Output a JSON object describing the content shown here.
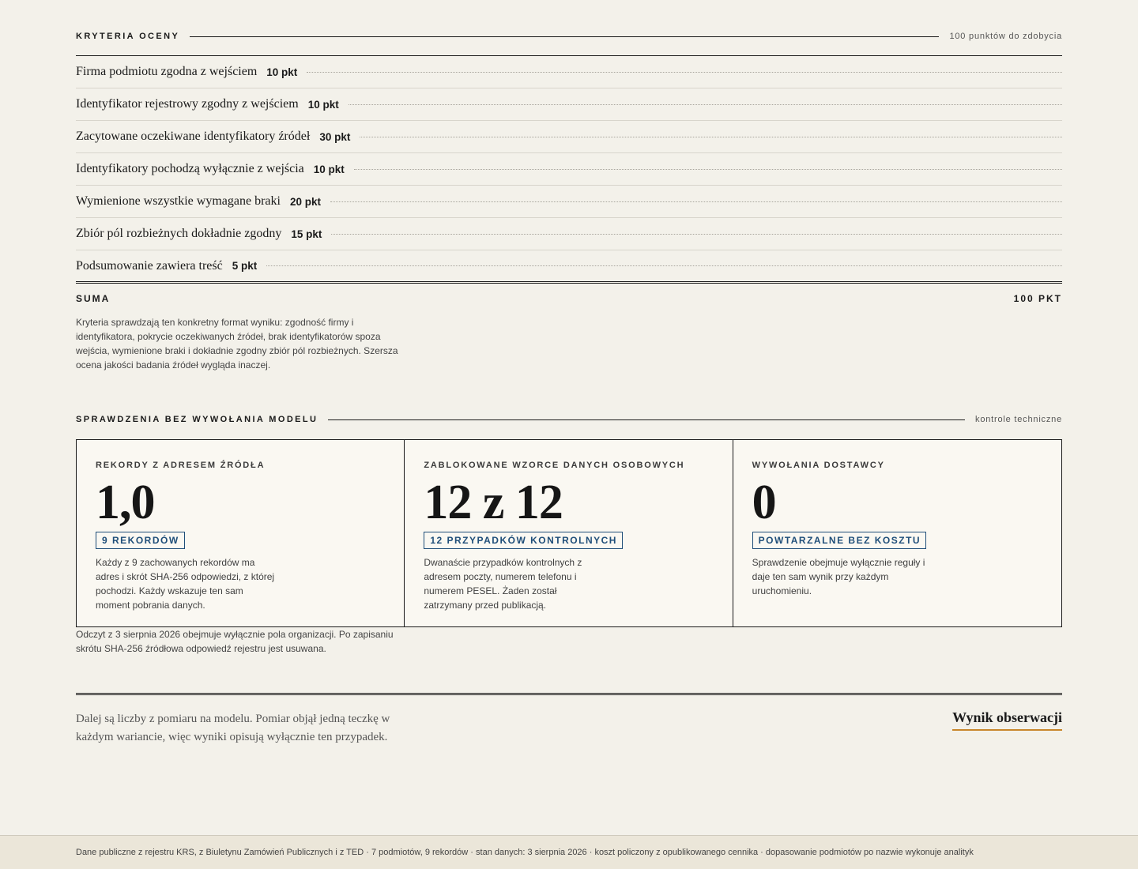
{
  "criteria": {
    "title": "KRYTERIA OCENY",
    "note": "100 punktów do zdobycia",
    "items": [
      {
        "label": "Firma podmiotu zgodna z wejściem",
        "points": "10 pkt"
      },
      {
        "label": "Identyfikator rejestrowy zgodny z wejściem",
        "points": "10 pkt"
      },
      {
        "label": "Zacytowane oczekiwane identyfikatory źródeł",
        "points": "30 pkt"
      },
      {
        "label": "Identyfikatory pochodzą wyłącznie z wejścia",
        "points": "10 pkt"
      },
      {
        "label": "Wymienione wszystkie wymagane braki",
        "points": "20 pkt"
      },
      {
        "label": "Zbiór pól rozbieżnych dokładnie zgodny",
        "points": "15 pkt"
      },
      {
        "label": "Podsumowanie zawiera treść",
        "points": "5 pkt"
      }
    ],
    "sum_label": "SUMA",
    "sum_value": "100 PKT",
    "description": "Kryteria sprawdzają ten konkretny format wyniku: zgodność firmy i identyfikatora, pokrycie oczekiwanych źródeł, brak identyfikatorów spoza wejścia, wymienione braki i dokładnie zgodny zbiór pól rozbieżnych. Szersza ocena jakości badania źródeł wygląda inaczej."
  },
  "checks": {
    "title": "SPRAWDZENIA BEZ WYWOŁANIA MODELU",
    "note": "kontrole techniczne",
    "cards": [
      {
        "title": "REKORDY Z ADRESEM ŹRÓDŁA",
        "value": "1,0",
        "badge": "9 REKORDÓW",
        "text": "Każdy z 9 zachowanych rekordów ma adres i skrót SHA-256 odpowiedzi, z której pochodzi. Każdy wskazuje ten sam moment pobrania danych."
      },
      {
        "title": "ZABLOKOWANE WZORCE DANYCH OSOBOWYCH",
        "value": "12 z 12",
        "badge": "12 PRZYPADKÓW KONTROLNYCH",
        "text": "Dwanaście przypadków kontrolnych z adresem poczty, numerem telefonu i numerem PESEL. Żaden został zatrzymany przed publikacją."
      },
      {
        "title": "WYWOŁANIA DOSTAWCY",
        "value": "0",
        "badge": "POWTARZALNE BEZ KOSZTU",
        "text": "Sprawdzenie obejmuje wyłącznie reguły i daje ten sam wynik przy każdym uruchomieniu."
      }
    ],
    "footnote": "Odczyt z 3 sierpnia 2026 obejmuje wyłącznie pola organizacji. Po zapisaniu skrótu SHA-256 źródłowa odpowiedź rejestru jest usuwana."
  },
  "observation": {
    "text": "Dalej są liczby z pomiaru na modelu. Pomiar objął jedną teczkę w każdym wariancie, więc wyniki opisują wyłącznie ten przypadek.",
    "link": "Wynik obserwacji"
  },
  "footer": {
    "text": "Dane publiczne z rejestru KRS, z Biuletynu Zamówień Publicznych i z TED · 7 podmiotów, 9 rekordów · stan danych: 3 sierpnia 2026 · koszt policzony z opublikowanego cennika · dopasowanie podmiotów po nazwie wykonuje analityk"
  },
  "colors": {
    "background": "#f3f1ea",
    "accent_blue": "#1f4e79",
    "accent_orange": "#c8872b",
    "footer_bg": "#ebe6d9"
  }
}
